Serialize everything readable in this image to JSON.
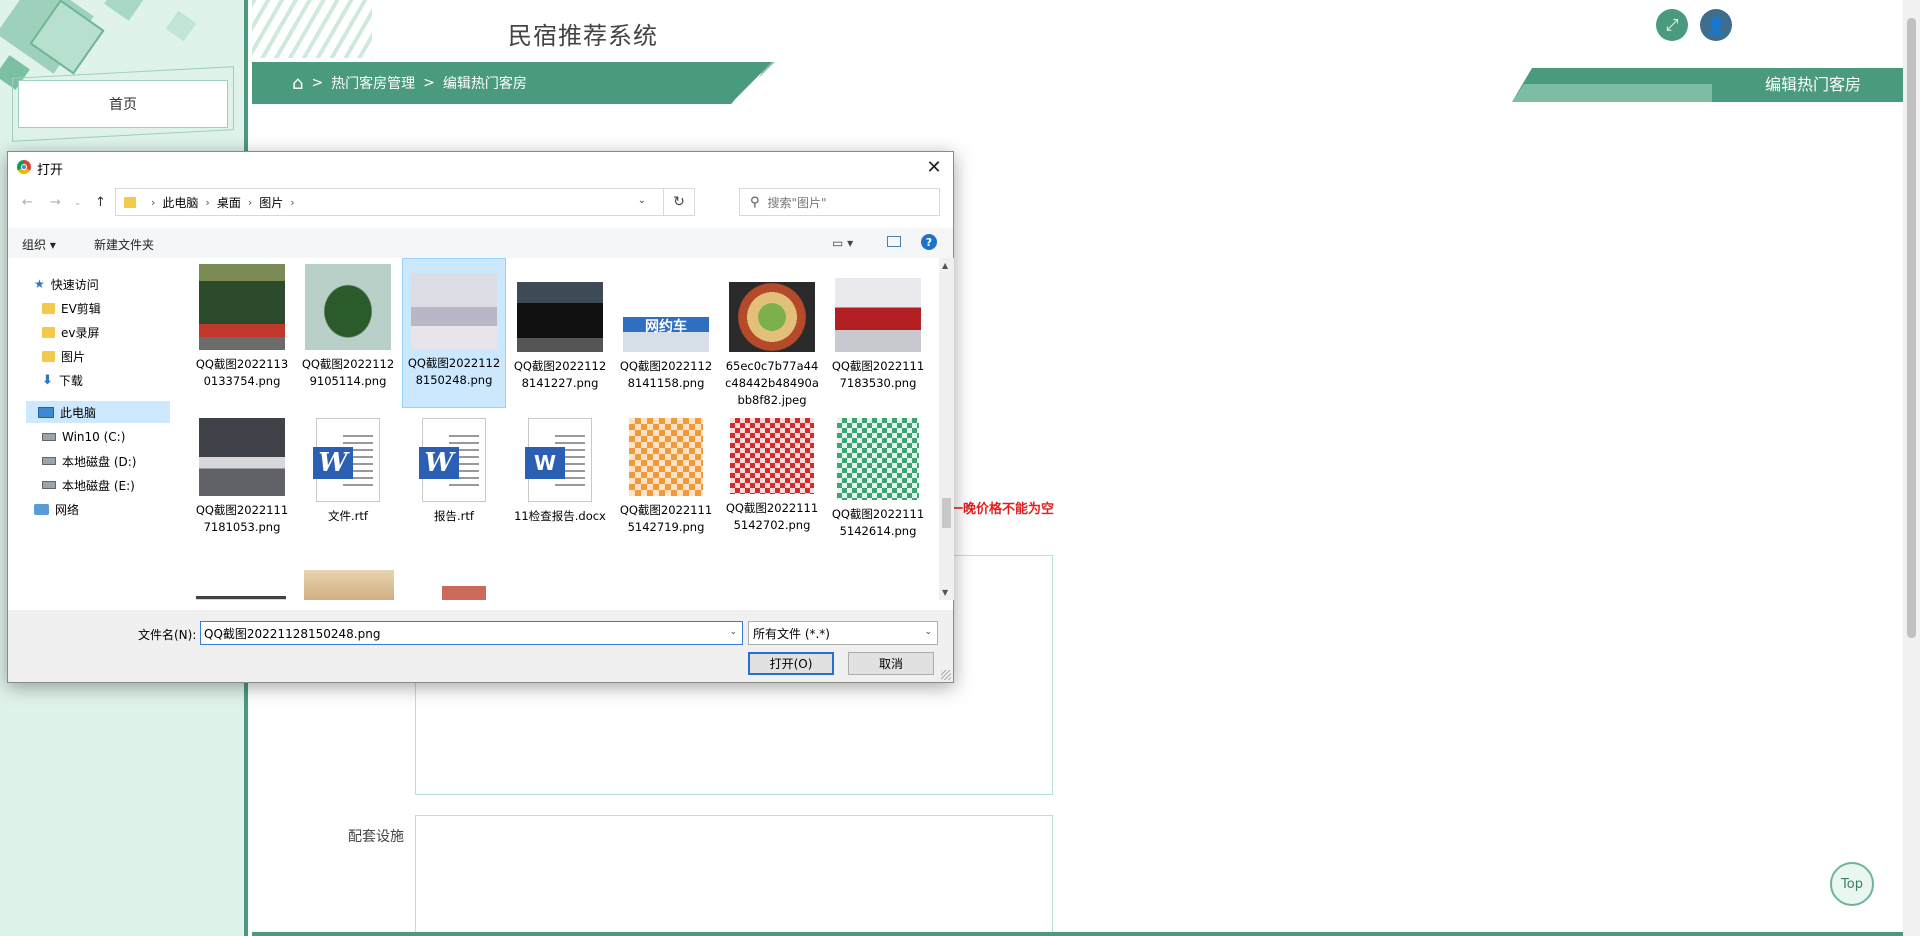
{
  "app": {
    "title": "民宿推荐系统",
    "breadcrumb": [
      "热门客房管理",
      "编辑热门客房"
    ],
    "page_tag": "编辑热门客房",
    "nav_home": "首页",
    "error_text": "一晚价格不能为空",
    "facilities_label": "配套设施",
    "top_button": "Top",
    "accent_color": "#4a9a7e"
  },
  "dialog": {
    "title": "打开",
    "close": "✕",
    "address": [
      "此电脑",
      "桌面",
      "图片"
    ],
    "search_placeholder": "搜索\"图片\"",
    "toolbar": {
      "organize": "组织 ▾",
      "new_folder": "新建文件夹"
    },
    "nav": {
      "quick_access": "快速访问",
      "folders": [
        "EV剪辑",
        "ev录屏",
        "图片",
        "下载"
      ],
      "this_pc": "此电脑",
      "drives": [
        "Win10 (C:)",
        "本地磁盘 (D:)",
        "本地磁盘 (E:)"
      ],
      "network": "网络"
    },
    "files": [
      {
        "name": "QQ截图20221130133754.png",
        "thumb": "vase1",
        "selected": false
      },
      {
        "name": "QQ截图20221129105114.png",
        "thumb": "vase2",
        "selected": false
      },
      {
        "name": "QQ截图20221128150248.png",
        "thumb": "room",
        "selected": true
      },
      {
        "name": "QQ截图20221128141227.png",
        "thumb": "car1",
        "selected": false
      },
      {
        "name": "QQ截图20221128141158.png",
        "thumb": "taxi",
        "selected": false
      },
      {
        "name": "65ec0c7b77a44c48442b48490abb8f82.jpeg",
        "thumb": "food",
        "selected": false
      },
      {
        "name": "QQ截图20221117183530.png",
        "thumb": "car2",
        "selected": false
      },
      {
        "name": "QQ截图20221117181053.png",
        "thumb": "car3",
        "selected": false
      },
      {
        "name": "文件.rtf",
        "thumb": "doc",
        "selected": false
      },
      {
        "name": "报告.rtf",
        "thumb": "doc",
        "selected": false
      },
      {
        "name": "11检查报告.docx",
        "thumb": "docx",
        "selected": false
      },
      {
        "name": "QQ截图20221115142719.png",
        "thumb": "qr-orange",
        "selected": false
      },
      {
        "name": "QQ截图20221115142702.png",
        "thumb": "qr-red",
        "selected": false
      },
      {
        "name": "QQ截图20221115142614.png",
        "thumb": "qr-green",
        "selected": false
      }
    ],
    "taxi_label": "网约车",
    "filename_label": "文件名(N):",
    "filename_value": "QQ截图20221128150248.png",
    "filetype_value": "所有文件 (*.*)",
    "open_button": "打开(O)",
    "cancel_button": "取消"
  }
}
